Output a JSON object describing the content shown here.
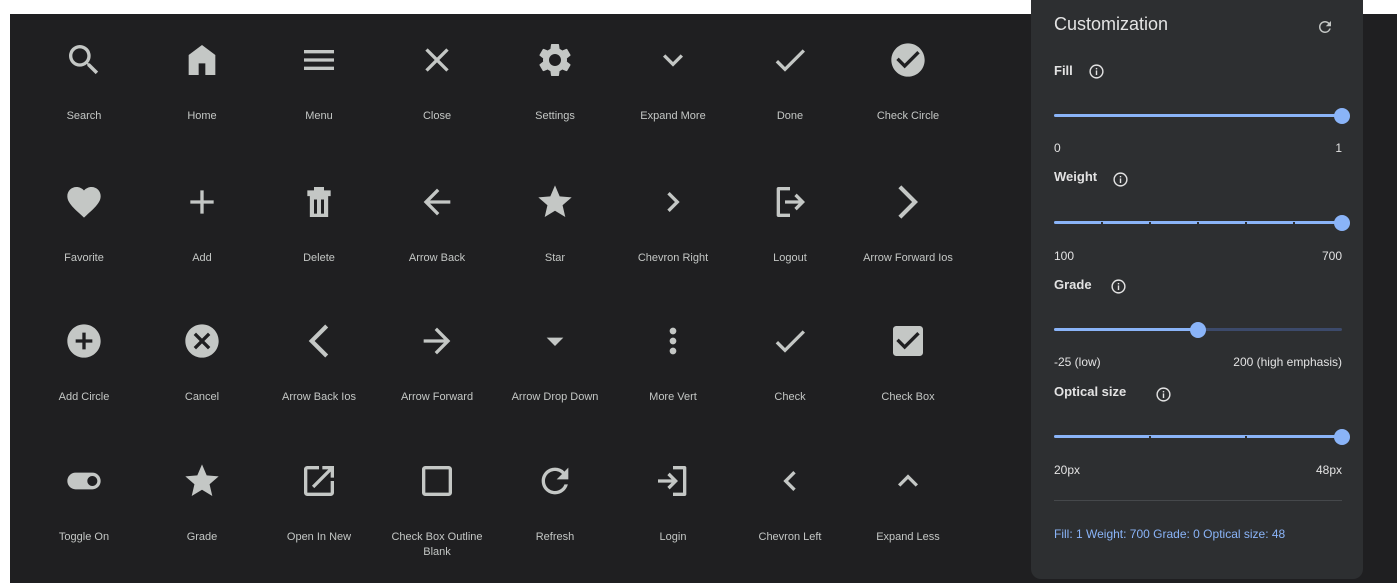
{
  "icons": [
    {
      "label": "Search",
      "icon": "search-icon"
    },
    {
      "label": "Home",
      "icon": "home-icon"
    },
    {
      "label": "Menu",
      "icon": "menu-icon"
    },
    {
      "label": "Close",
      "icon": "close-icon"
    },
    {
      "label": "Settings",
      "icon": "settings-icon"
    },
    {
      "label": "Expand More",
      "icon": "expand-more-icon"
    },
    {
      "label": "Done",
      "icon": "done-icon"
    },
    {
      "label": "Check Circle",
      "icon": "check-circle-icon"
    },
    {
      "label": "Favorite",
      "icon": "favorite-icon"
    },
    {
      "label": "Add",
      "icon": "add-icon"
    },
    {
      "label": "Delete",
      "icon": "delete-icon"
    },
    {
      "label": "Arrow Back",
      "icon": "arrow-back-icon"
    },
    {
      "label": "Star",
      "icon": "star-icon"
    },
    {
      "label": "Chevron Right",
      "icon": "chevron-right-icon"
    },
    {
      "label": "Logout",
      "icon": "logout-icon"
    },
    {
      "label": "Arrow Forward Ios",
      "icon": "arrow-forward-ios-icon"
    },
    {
      "label": "Add Circle",
      "icon": "add-circle-icon"
    },
    {
      "label": "Cancel",
      "icon": "cancel-icon"
    },
    {
      "label": "Arrow Back Ios",
      "icon": "arrow-back-ios-icon"
    },
    {
      "label": "Arrow Forward",
      "icon": "arrow-forward-icon"
    },
    {
      "label": "Arrow Drop Down",
      "icon": "arrow-drop-down-icon"
    },
    {
      "label": "More Vert",
      "icon": "more-vert-icon"
    },
    {
      "label": "Check",
      "icon": "check-icon"
    },
    {
      "label": "Check Box",
      "icon": "check-box-icon"
    },
    {
      "label": "Toggle On",
      "icon": "toggle-on-icon"
    },
    {
      "label": "Grade",
      "icon": "grade-icon"
    },
    {
      "label": "Open In New",
      "icon": "open-in-new-icon"
    },
    {
      "label": "Check Box Outline Blank",
      "icon": "check-box-outline-blank-icon"
    },
    {
      "label": "Refresh",
      "icon": "refresh-icon"
    },
    {
      "label": "Login",
      "icon": "login-icon"
    },
    {
      "label": "Chevron Left",
      "icon": "chevron-left-icon"
    },
    {
      "label": "Expand Less",
      "icon": "expand-less-icon"
    }
  ],
  "panel": {
    "title": "Customization",
    "fill": {
      "label": "Fill",
      "min": "0",
      "max": "1",
      "value_fraction": 1.0
    },
    "weight": {
      "label": "Weight",
      "min": "100",
      "max": "700",
      "value_fraction": 1.0
    },
    "grade": {
      "label": "Grade",
      "min": "-25 (low)",
      "max": "200 (high emphasis)",
      "value_fraction": 0.5
    },
    "optical": {
      "label": "Optical size",
      "min": "20px",
      "max": "48px",
      "value_fraction": 1.0
    },
    "summary": "Fill: 1 Weight: 700 Grade: 0 Optical size: 48"
  },
  "colors": {
    "icon": "#c4c7c5",
    "accent": "#8ab4f8",
    "panel": "#2d2f31",
    "background": "#1f1f21"
  }
}
